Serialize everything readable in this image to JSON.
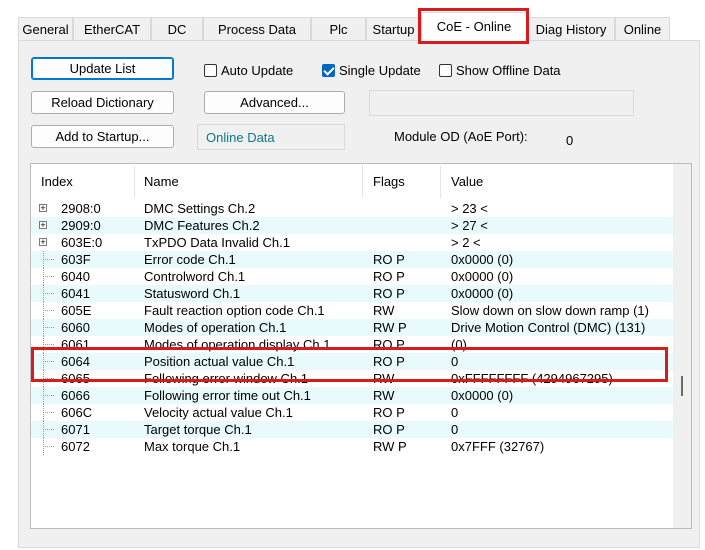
{
  "tabs": [
    {
      "label": "General"
    },
    {
      "label": "EtherCAT"
    },
    {
      "label": "DC"
    },
    {
      "label": "Process Data"
    },
    {
      "label": "Plc"
    },
    {
      "label": "Startup"
    },
    {
      "label": "CoE - Online"
    },
    {
      "label": "Diag History"
    },
    {
      "label": "Online"
    }
  ],
  "buttons": {
    "update_list": "Update List",
    "reload_dictionary": "Reload Dictionary",
    "add_to_startup": "Add to Startup...",
    "advanced": "Advanced..."
  },
  "checkboxes": {
    "auto_update": {
      "label": "Auto Update",
      "checked": false
    },
    "single_update": {
      "label": "Single Update",
      "checked": true
    },
    "show_offline": {
      "label": "Show Offline Data",
      "checked": false
    }
  },
  "online_data": "Online Data",
  "module_od_label": "Module OD (AoE Port):",
  "module_od_value": "0",
  "columns": {
    "index": "Index",
    "name": "Name",
    "flags": "Flags",
    "value": "Value"
  },
  "rows": [
    {
      "index": "2908:0",
      "name": "DMC Settings Ch.2",
      "flags": "",
      "value": "> 23 <",
      "expandable": true
    },
    {
      "index": "2909:0",
      "name": "DMC Features Ch.2",
      "flags": "",
      "value": "> 27 <",
      "expandable": true
    },
    {
      "index": "603E:0",
      "name": "TxPDO Data Invalid Ch.1",
      "flags": "",
      "value": "> 2 <",
      "expandable": true
    },
    {
      "index": "603F",
      "name": "Error code Ch.1",
      "flags": "RO P",
      "value": "0x0000 (0)"
    },
    {
      "index": "6040",
      "name": "Controlword Ch.1",
      "flags": "RO P",
      "value": "0x0000 (0)"
    },
    {
      "index": "6041",
      "name": "Statusword Ch.1",
      "flags": "RO P",
      "value": "0x0000 (0)"
    },
    {
      "index": "605E",
      "name": "Fault reaction option code Ch.1",
      "flags": "RW",
      "value": "Slow down on slow down ramp (1)"
    },
    {
      "index": "6060",
      "name": "Modes of operation Ch.1",
      "flags": "RW P",
      "value": "Drive Motion Control (DMC) (131)"
    },
    {
      "index": "6061",
      "name": "Modes of operation display Ch.1",
      "flags": "RO P",
      "value": "(0)"
    },
    {
      "index": "6064",
      "name": "Position actual value Ch.1",
      "flags": "RO P",
      "value": "0"
    },
    {
      "index": "6065",
      "name": "Following error window Ch.1",
      "flags": "RW",
      "value": "0xFFFFFFFF (4294967295)"
    },
    {
      "index": "6066",
      "name": "Following error time out Ch.1",
      "flags": "RW",
      "value": "0x0000 (0)"
    },
    {
      "index": "606C",
      "name": "Velocity actual value Ch.1",
      "flags": "RO P",
      "value": "0"
    },
    {
      "index": "6071",
      "name": "Target torque Ch.1",
      "flags": "RO P",
      "value": "0"
    },
    {
      "index": "6072",
      "name": "Max torque Ch.1",
      "flags": "RW P",
      "value": "0x7FFF (32767)"
    }
  ],
  "highlight_color": "#d81c1c",
  "row_alt_color": "#e8fafc"
}
